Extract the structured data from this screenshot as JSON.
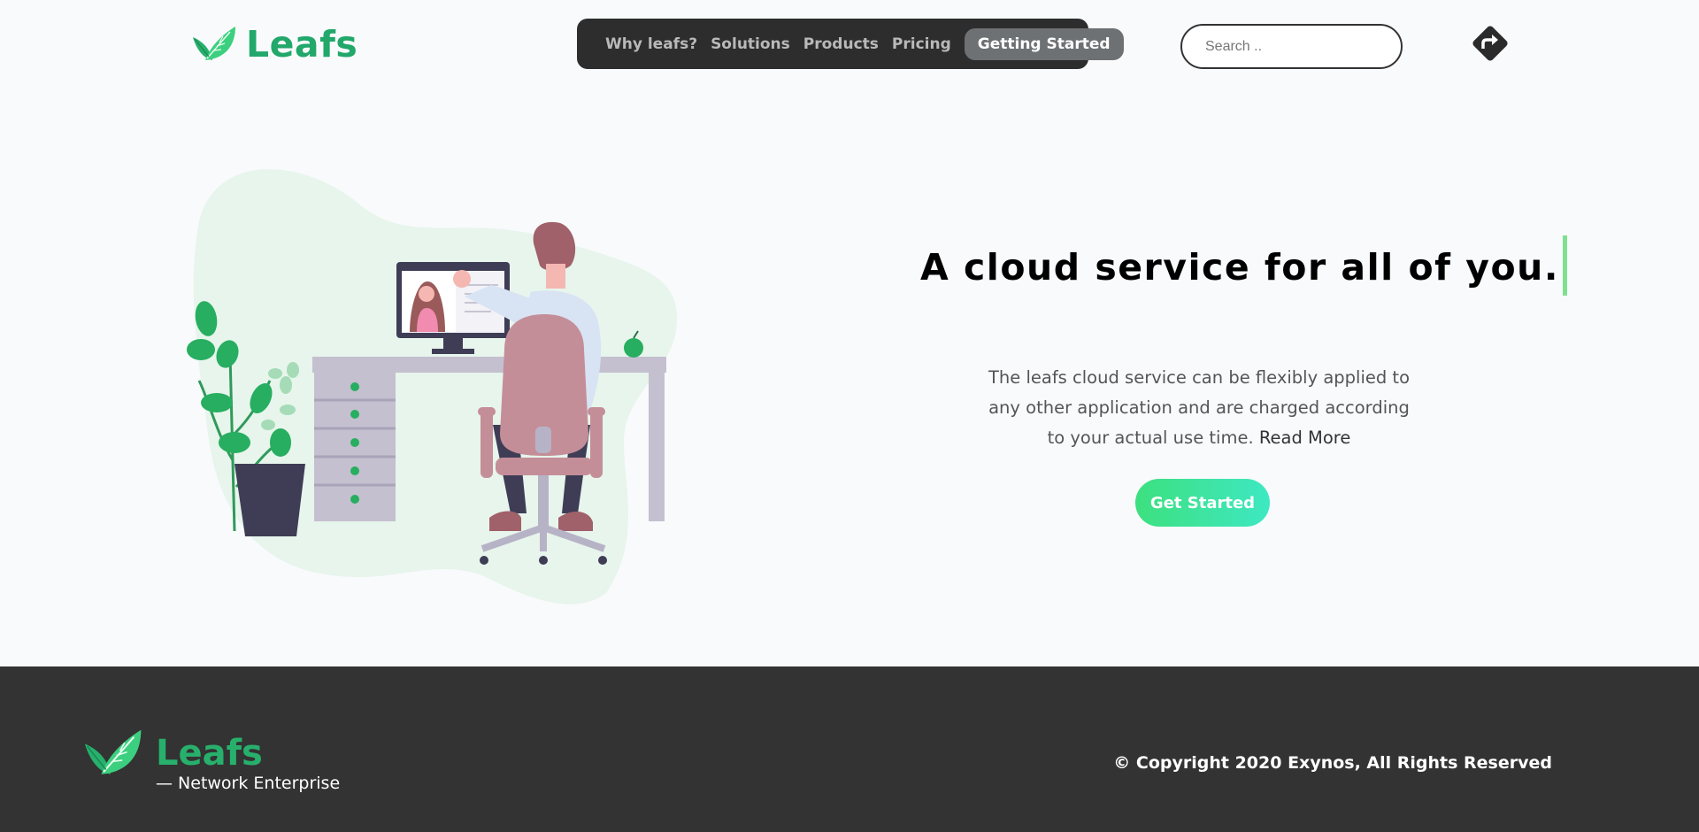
{
  "header": {
    "brand": "Leafs",
    "nav": [
      {
        "label": "Why leafs?"
      },
      {
        "label": "Solutions"
      },
      {
        "label": "Products"
      },
      {
        "label": "Pricing"
      },
      {
        "label": "Getting Started",
        "active": true
      }
    ],
    "search": {
      "placeholder": "Search ..",
      "value": ""
    },
    "direction_icon": "turn-right-sign-icon"
  },
  "hero": {
    "headline": "A cloud service for all of you.",
    "description": "The leafs cloud service can be flexibly applied to any other application and are charged according to your actual use time.",
    "read_more": "Read More",
    "cta": "Get Started",
    "illustration": "person-at-desk-video-call-illustration"
  },
  "footer": {
    "brand": "Leafs",
    "tagline": "— Network Enterprise",
    "copyright": "© Copyright 2020 Exynos, All Rights Reserved"
  },
  "colors": {
    "brand_green": "#21a86a",
    "nav_bg": "#2d2d2d",
    "footer_bg": "#333333",
    "cta_gradient_start": "#3de07f",
    "cta_gradient_end": "#3ee8c2",
    "page_bg": "#f9fafc"
  }
}
